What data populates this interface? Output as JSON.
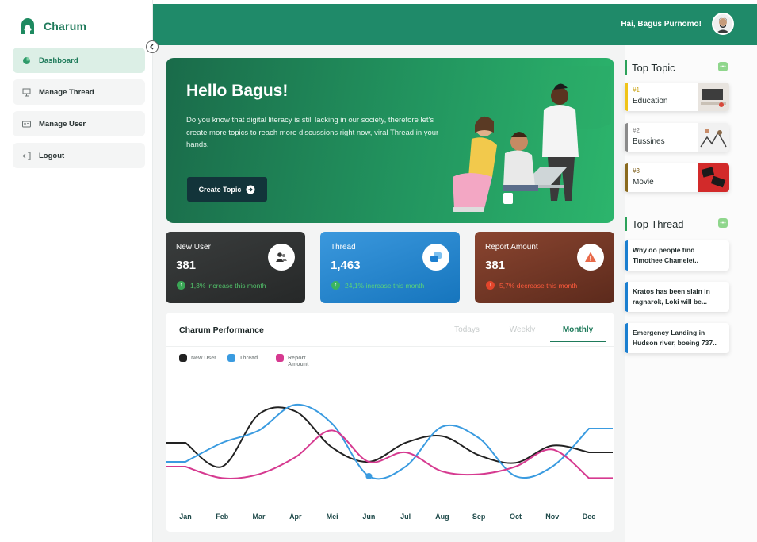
{
  "app": {
    "name": "Charum"
  },
  "sidebar": {
    "items": [
      {
        "label": "Dashboard",
        "icon": "pie-chart-icon",
        "active": true
      },
      {
        "label": "Manage Thread",
        "icon": "presentation-icon",
        "active": false
      },
      {
        "label": "Manage User",
        "icon": "id-card-icon",
        "active": false
      },
      {
        "label": "Logout",
        "icon": "logout-icon",
        "active": false
      }
    ]
  },
  "header": {
    "greeting": "Hai, Bagus Purnomo!"
  },
  "hero": {
    "title": "Hello Bagus!",
    "text": "Do you know that digital literacy is still lacking in our society, therefore let's create more topics to reach more discussions right now, viral Thread in your hands.",
    "button": "Create Topic"
  },
  "stats": [
    {
      "label": "New User",
      "value": "381",
      "note": "1,3% increase this month",
      "trend": "up"
    },
    {
      "label": "Thread",
      "value": "1,463",
      "note": "24,1% increase this month",
      "trend": "up"
    },
    {
      "label": "Report Amount",
      "value": "381",
      "note": "5,7% decrease this month",
      "trend": "down"
    }
  ],
  "performance": {
    "title": "Charum Performance",
    "tabs": [
      "Todays",
      "Weekly",
      "Monthly"
    ],
    "active_tab": "Monthly"
  },
  "chart_data": {
    "type": "line",
    "categories": [
      "Jan",
      "Feb",
      "Mar",
      "Apr",
      "Mei",
      "Jun",
      "Jul",
      "Aug",
      "Sep",
      "Oct",
      "Nov",
      "Dec"
    ],
    "series": [
      {
        "name": "New User",
        "color": "#222222",
        "values": [
          55,
          30,
          85,
          88,
          50,
          35,
          55,
          62,
          42,
          34,
          52,
          45
        ]
      },
      {
        "name": "Thread",
        "color": "#3a9be0",
        "values": [
          35,
          55,
          68,
          95,
          75,
          20,
          30,
          72,
          60,
          20,
          30,
          70
        ]
      },
      {
        "name": "Report Amount",
        "color": "#d63a90",
        "values": [
          30,
          18,
          22,
          40,
          68,
          35,
          45,
          25,
          22,
          30,
          48,
          18
        ]
      }
    ],
    "ylim": [
      0,
      100
    ],
    "legend": "top-left",
    "grid": false
  },
  "top_topic": {
    "title": "Top Topic",
    "more_icon": "more-icon",
    "items": [
      {
        "rank": "#1",
        "name": "Education",
        "color": "#f0c419"
      },
      {
        "rank": "#2",
        "name": "Bussines",
        "color": "#8a8a8a"
      },
      {
        "rank": "#3",
        "name": "Movie",
        "color": "#8a6a1e"
      }
    ]
  },
  "top_thread": {
    "title": "Top Thread",
    "items": [
      {
        "title": "Why do people find Timothee Chamelet.."
      },
      {
        "title": "Kratos has been slain in ragnarok, Loki will be..."
      },
      {
        "title": "Emergency Landing in Hudson river, boeing 737.."
      }
    ]
  }
}
